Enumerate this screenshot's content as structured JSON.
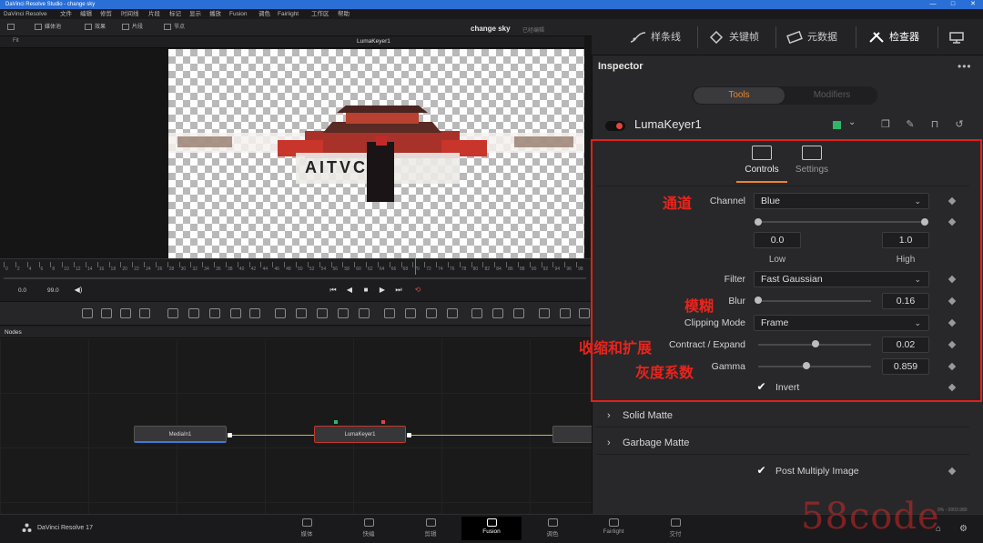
{
  "window": {
    "title": "DaVinci Resolve Studio - change sky"
  },
  "menu": [
    "DaVinci Resolve",
    "文件",
    "编辑",
    "修剪",
    "时间线",
    "片段",
    "标记",
    "显示",
    "播放",
    "Fusion",
    "调色",
    "Fairlight",
    "工作区",
    "帮助"
  ],
  "viewer_toolbar": {
    "items": [
      "媒体池",
      "效果",
      "片段",
      "节点"
    ],
    "project_name": "change sky",
    "project_status": "已经编辑",
    "viewer_label": "LumaKeyer1",
    "zoom": "Fit"
  },
  "right_header": {
    "buttons": [
      "样条线",
      "关键帧",
      "元数据",
      "检查器"
    ]
  },
  "viewer": {
    "image_text": "AITVC"
  },
  "ruler": [
    "0",
    "2",
    "4",
    "6",
    "8",
    "10",
    "12",
    "14",
    "16",
    "18",
    "20",
    "22",
    "24",
    "26",
    "28",
    "30",
    "32",
    "34",
    "36",
    "38",
    "40",
    "42",
    "44",
    "46",
    "48",
    "50",
    "52",
    "54",
    "56",
    "58",
    "60",
    "62",
    "64",
    "66",
    "68",
    "70",
    "72",
    "74",
    "76",
    "78",
    "80",
    "82",
    "84",
    "86",
    "88",
    "90",
    "92",
    "94",
    "96",
    "98"
  ],
  "transport": {
    "start": "0.0",
    "end": "99.0"
  },
  "nodes": {
    "title": "Nodes",
    "items": [
      "MediaIn1",
      "LumaKeyer1"
    ]
  },
  "inspector": {
    "title": "Inspector",
    "tabs": {
      "tools": "Tools",
      "modifiers": "Modifiers"
    },
    "tool_name": "LumaKeyer1",
    "subtabs": {
      "controls": "Controls",
      "settings": "Settings"
    },
    "channel": {
      "label": "Channel",
      "value": "Blue",
      "zh": "通道"
    },
    "range": {
      "low": "0.0",
      "high": "1.0",
      "low_label": "Low",
      "high_label": "High",
      "low_frac": 0.0,
      "high_frac": 1.0
    },
    "filter": {
      "label": "Filter",
      "value": "Fast Gaussian"
    },
    "blur": {
      "label": "Blur",
      "value": "0.16",
      "zh": "模糊",
      "frac": 0.0
    },
    "clipping": {
      "label": "Clipping Mode",
      "value": "Frame"
    },
    "contract": {
      "label": "Contract / Expand",
      "value": "0.02",
      "zh": "收缩和扩展",
      "frac": 0.51
    },
    "gamma": {
      "label": "Gamma",
      "value": "0.859",
      "zh": "灰度系数",
      "frac": 0.43
    },
    "invert": {
      "label": "Invert",
      "checked": true
    },
    "sections": [
      "Solid Matte",
      "Garbage Matte"
    ],
    "post_multiply": {
      "label": "Post Multiply Image",
      "checked": true
    }
  },
  "bottom": {
    "app": "DaVinci Resolve 17",
    "pages": [
      "媒体",
      "快编",
      "剪辑",
      "Fusion",
      "调色",
      "Fairlight",
      "交付"
    ],
    "active_page": "Fusion",
    "watermark": "58code",
    "status": "9% - 0003.980"
  },
  "colors": {
    "accent": "#e8862a",
    "annotation": "#e0201a",
    "node_color": "#2fb56a"
  }
}
